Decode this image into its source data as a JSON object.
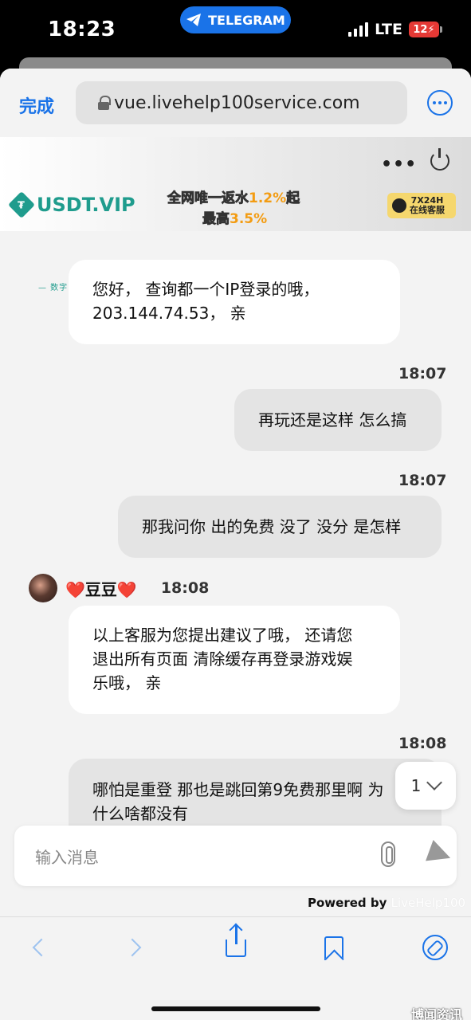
{
  "status_bar": {
    "time": "18:23",
    "back_app": "TELEGRAM",
    "network": "LTE",
    "battery": "12"
  },
  "browser": {
    "done_label": "完成",
    "url": "vue.livehelp100service.com"
  },
  "banner": {
    "logo_text": "USDT.VIP",
    "logo_subtitle": "— 数字网投领导者 —",
    "promo_line1_prefix": "全网唯一返水",
    "promo_line1_value": "1.2%",
    "promo_line1_suffix": "起",
    "promo_line2_prefix": "最高",
    "promo_line2_value": "3.5%",
    "service_badge_line1": "7X24H",
    "service_badge_line2": "在线客服"
  },
  "messages": [
    {
      "direction": "in",
      "text_lines": [
        "您好， 查询都一个IP登录的哦，",
        "203.144.74.53， 亲"
      ]
    },
    {
      "direction": "out",
      "time": "18:07",
      "text_lines": [
        "再玩还是这样 怎么搞"
      ]
    },
    {
      "direction": "out",
      "time": "18:07",
      "text_lines": [
        "那我问你 出的免费 没了 没分 是怎样"
      ]
    },
    {
      "direction": "in",
      "sender": "❤️豆豆❤️",
      "time": "18:08",
      "text_lines": [
        "以上客服为您提出建议了哦， 还请您",
        "退出所有页面 清除缓存再登录游戏娱",
        "乐哦， 亲"
      ]
    },
    {
      "direction": "out",
      "time": "18:08",
      "text_lines": [
        "哪怕是重登 那也是跳回第9免费那里啊 为",
        "什么啥都没有"
      ]
    }
  ],
  "scroll_badge": "1",
  "composer": {
    "placeholder": "输入消息"
  },
  "footer": {
    "powered_by": "Powered by",
    "brand": "LiveHelp100"
  },
  "watermark": "博闻资讯",
  "colors": {
    "accent": "#1a73e8",
    "logo": "#1f9c8d",
    "promo_highlight": "#f39c12",
    "battery": "#e53935"
  }
}
